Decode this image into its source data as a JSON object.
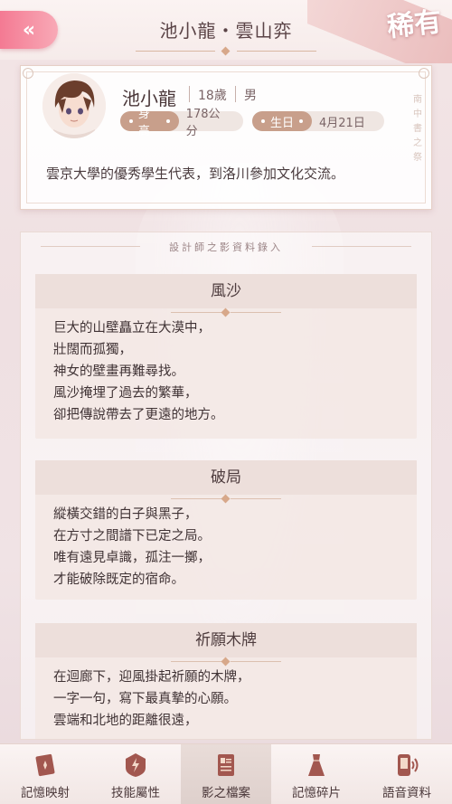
{
  "header": {
    "back_icon": "double-chevron-left-icon",
    "title": "池小龍・雲山弈",
    "rarity": "稀有"
  },
  "profile": {
    "name": "池小龍",
    "age": "18歲",
    "gender": "男",
    "height_label": "身高",
    "height_value": "178公分",
    "birthday_label": "生日",
    "birthday_value": "4月21日",
    "description": "雲京大學的優秀學生代表，到洛川參加文化交流。",
    "side_text": [
      "南",
      "中",
      "書",
      "之",
      "祭"
    ]
  },
  "records": {
    "heading": "設計師之影資料錄入",
    "cards": [
      {
        "title": "風沙",
        "lines": [
          "巨大的山壁矗立在大漠中，",
          "壯闊而孤獨，",
          "神女的壁畫再難尋找。",
          "風沙掩埋了過去的繁華，",
          "卻把傳說帶去了更遠的地方。"
        ]
      },
      {
        "title": "破局",
        "lines": [
          "縱橫交錯的白子與黑子，",
          "在方寸之間譜下已定之局。",
          "唯有遠見卓識，孤注一擲，",
          "才能破除既定的宿命。"
        ]
      },
      {
        "title": "祈願木牌",
        "lines": [
          "在迴廊下，迎風掛起祈願的木牌，",
          "一字一句，寫下最真摯的心願。",
          "雲端和北地的距離很遠，"
        ]
      }
    ]
  },
  "bottom_nav": [
    {
      "label": "記憶映射",
      "icon": "memory-card-icon",
      "active": false
    },
    {
      "label": "技能屬性",
      "icon": "lightning-shield-icon",
      "active": false
    },
    {
      "label": "影之檔案",
      "icon": "profile-document-icon",
      "active": true
    },
    {
      "label": "記憶碎片",
      "icon": "dress-icon",
      "active": false
    },
    {
      "label": "語音資料",
      "icon": "phone-audio-icon",
      "active": false
    }
  ]
}
